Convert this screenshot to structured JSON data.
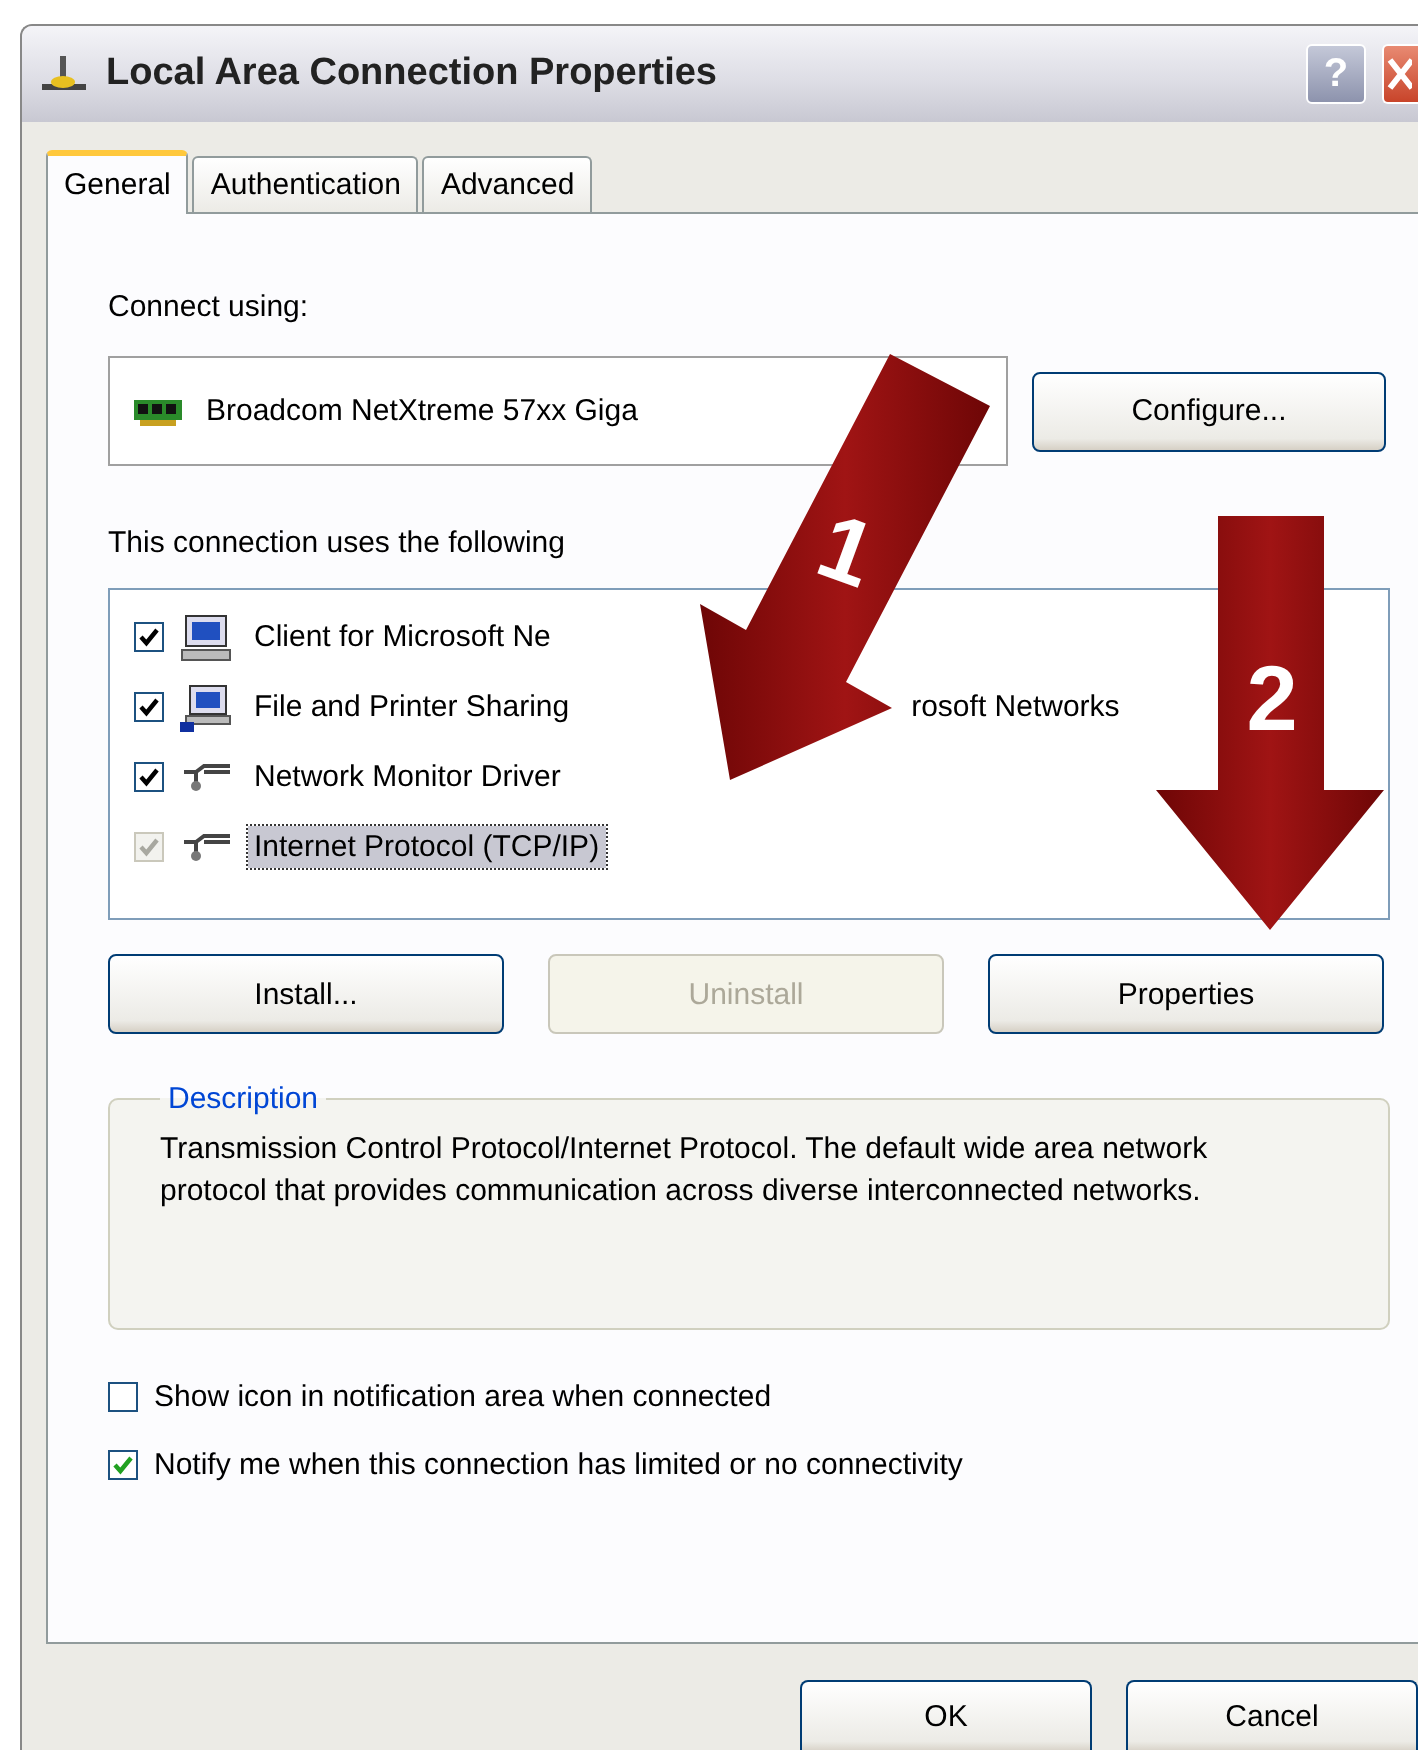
{
  "window": {
    "title": "Local Area Connection Properties",
    "help_button": "?"
  },
  "tabs": [
    {
      "label": "General",
      "selected": true
    },
    {
      "label": "Authentication",
      "selected": false
    },
    {
      "label": "Advanced",
      "selected": false
    }
  ],
  "connect_using": {
    "label": "Connect using:",
    "adapter": "Broadcom NetXtreme 57xx Giga",
    "button": "Configure..."
  },
  "components": {
    "label": "This connection uses the following",
    "items": [
      {
        "label": "Client for Microsoft Ne",
        "kind": "client",
        "checked": true,
        "disabled": false,
        "selected": false
      },
      {
        "label": "File and Printer Sharing",
        "label_continued": "rosoft Networks",
        "kind": "service",
        "checked": true,
        "disabled": false,
        "selected": false
      },
      {
        "label": "Network Monitor Driver",
        "kind": "protocol",
        "checked": true,
        "disabled": false,
        "selected": false
      },
      {
        "label": "Internet Protocol (TCP/IP)",
        "kind": "protocol",
        "checked": true,
        "disabled": true,
        "selected": true
      }
    ]
  },
  "action_buttons": [
    {
      "label": "Install...",
      "disabled": false
    },
    {
      "label": "Uninstall",
      "disabled": true
    },
    {
      "label": "Properties",
      "disabled": false
    }
  ],
  "description": {
    "title": "Description",
    "text": "Transmission Control Protocol/Internet Protocol. The default wide area network protocol that provides communication across diverse interconnected networks."
  },
  "options": [
    {
      "label": "Show icon in notification area when connected",
      "checked": false
    },
    {
      "label": "Notify me when this connection has limited or no connectivity",
      "checked": true
    }
  ],
  "dialog_buttons": [
    "OK",
    "Cancel"
  ],
  "annotations": [
    {
      "label": "1",
      "kind": "diagonal"
    },
    {
      "label": "2",
      "kind": "down"
    }
  ]
}
